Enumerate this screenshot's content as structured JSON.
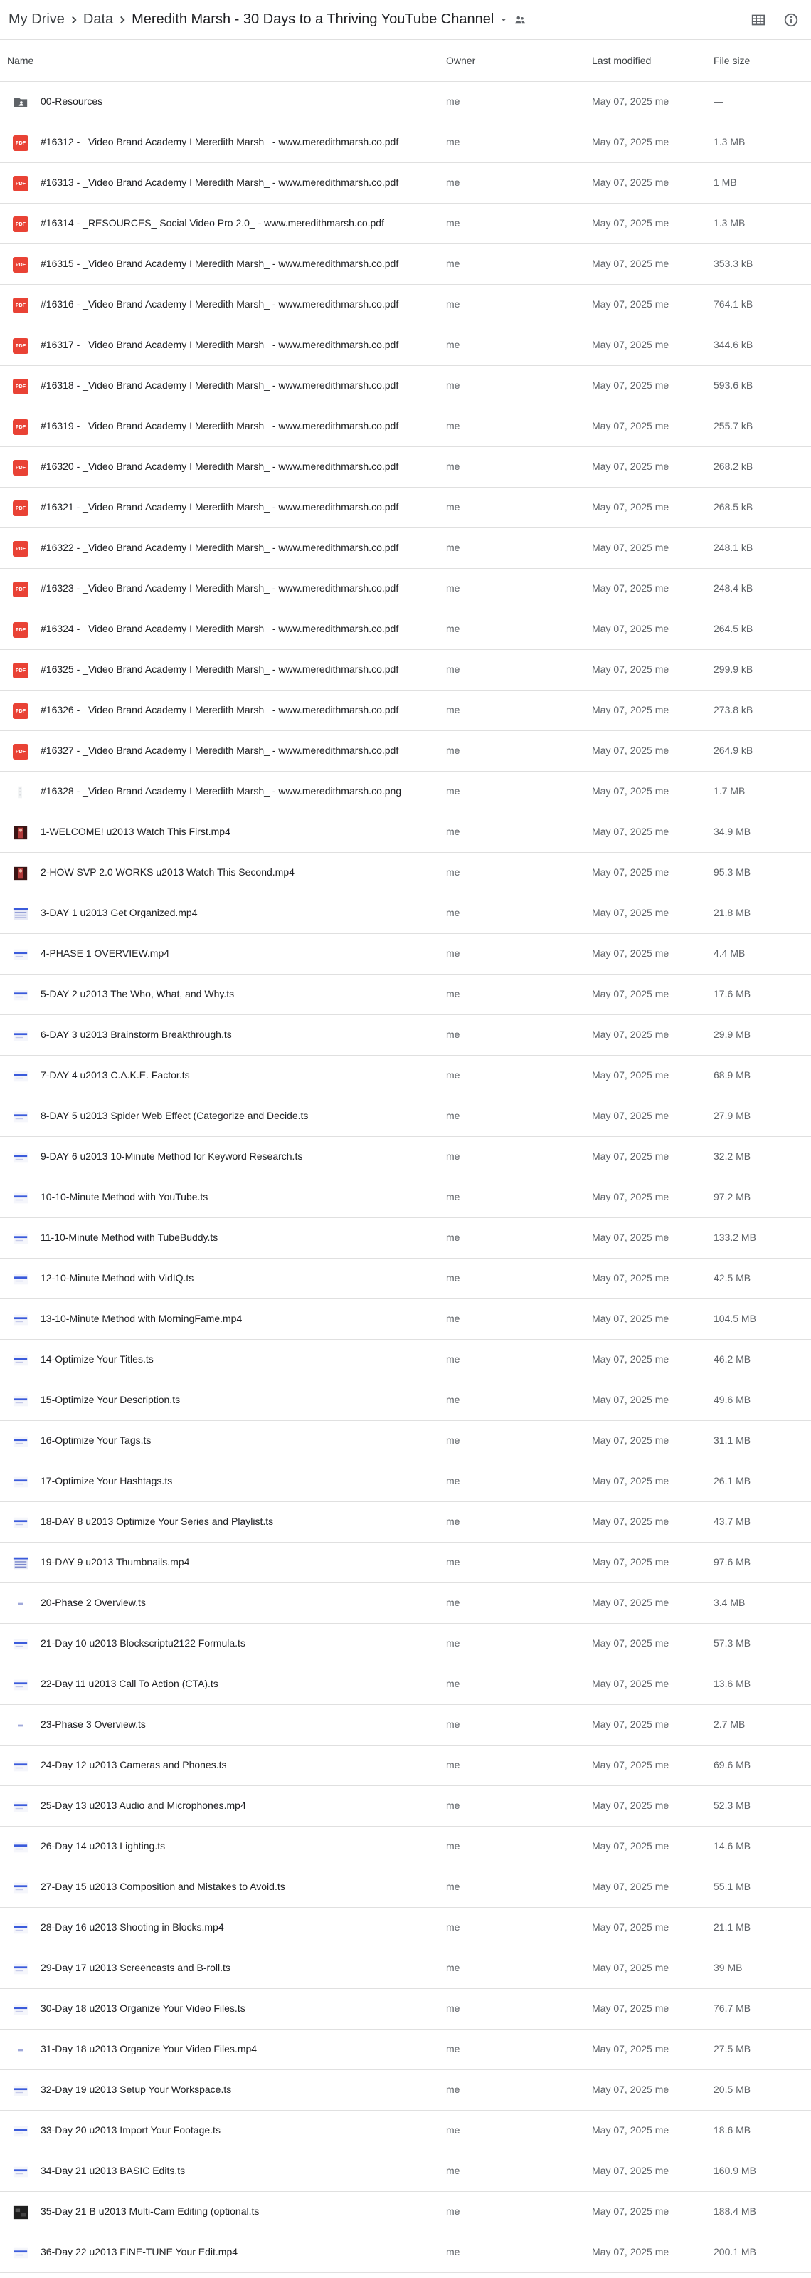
{
  "breadcrumb": {
    "items": [
      "My Drive",
      "Data",
      "Meredith Marsh - 30 Days to a Thriving YouTube Channel"
    ]
  },
  "columns": {
    "name": "Name",
    "owner": "Owner",
    "modified": "Last modified",
    "size": "File size"
  },
  "files": [
    {
      "type": "folder",
      "name": "00-Resources",
      "owner": "me",
      "modified": "May 07, 2025 me",
      "size": "—"
    },
    {
      "type": "pdf",
      "name": "#16312 - _Video Brand Academy I Meredith Marsh_ - www.meredithmarsh.co.pdf",
      "owner": "me",
      "modified": "May 07, 2025 me",
      "size": "1.3 MB"
    },
    {
      "type": "pdf",
      "name": "#16313 - _Video Brand Academy I Meredith Marsh_ - www.meredithmarsh.co.pdf",
      "owner": "me",
      "modified": "May 07, 2025 me",
      "size": "1 MB"
    },
    {
      "type": "pdf",
      "name": "#16314 - _RESOURCES_ Social Video Pro 2.0_ - www.meredithmarsh.co.pdf",
      "owner": "me",
      "modified": "May 07, 2025 me",
      "size": "1.3 MB"
    },
    {
      "type": "pdf",
      "name": "#16315 - _Video Brand Academy I Meredith Marsh_ - www.meredithmarsh.co.pdf",
      "owner": "me",
      "modified": "May 07, 2025 me",
      "size": "353.3 kB"
    },
    {
      "type": "pdf",
      "name": "#16316 - _Video Brand Academy I Meredith Marsh_ - www.meredithmarsh.co.pdf",
      "owner": "me",
      "modified": "May 07, 2025 me",
      "size": "764.1 kB"
    },
    {
      "type": "pdf",
      "name": "#16317 - _Video Brand Academy I Meredith Marsh_ - www.meredithmarsh.co.pdf",
      "owner": "me",
      "modified": "May 07, 2025 me",
      "size": "344.6 kB"
    },
    {
      "type": "pdf",
      "name": "#16318 - _Video Brand Academy I Meredith Marsh_ - www.meredithmarsh.co.pdf",
      "owner": "me",
      "modified": "May 07, 2025 me",
      "size": "593.6 kB"
    },
    {
      "type": "pdf",
      "name": "#16319 - _Video Brand Academy I Meredith Marsh_ - www.meredithmarsh.co.pdf",
      "owner": "me",
      "modified": "May 07, 2025 me",
      "size": "255.7 kB"
    },
    {
      "type": "pdf",
      "name": "#16320 - _Video Brand Academy I Meredith Marsh_ - www.meredithmarsh.co.pdf",
      "owner": "me",
      "modified": "May 07, 2025 me",
      "size": "268.2 kB"
    },
    {
      "type": "pdf",
      "name": "#16321 - _Video Brand Academy I Meredith Marsh_ - www.meredithmarsh.co.pdf",
      "owner": "me",
      "modified": "May 07, 2025 me",
      "size": "268.5 kB"
    },
    {
      "type": "pdf",
      "name": "#16322 - _Video Brand Academy I Meredith Marsh_ - www.meredithmarsh.co.pdf",
      "owner": "me",
      "modified": "May 07, 2025 me",
      "size": "248.1 kB"
    },
    {
      "type": "pdf",
      "name": "#16323 - _Video Brand Academy I Meredith Marsh_ - www.meredithmarsh.co.pdf",
      "owner": "me",
      "modified": "May 07, 2025 me",
      "size": "248.4 kB"
    },
    {
      "type": "pdf",
      "name": "#16324 - _Video Brand Academy I Meredith Marsh_ - www.meredithmarsh.co.pdf",
      "owner": "me",
      "modified": "May 07, 2025 me",
      "size": "264.5 kB"
    },
    {
      "type": "pdf",
      "name": "#16325 - _Video Brand Academy I Meredith Marsh_ - www.meredithmarsh.co.pdf",
      "owner": "me",
      "modified": "May 07, 2025 me",
      "size": "299.9 kB"
    },
    {
      "type": "pdf",
      "name": "#16326 - _Video Brand Academy I Meredith Marsh_ - www.meredithmarsh.co.pdf",
      "owner": "me",
      "modified": "May 07, 2025 me",
      "size": "273.8 kB"
    },
    {
      "type": "pdf",
      "name": "#16327 - _Video Brand Academy I Meredith Marsh_ - www.meredithmarsh.co.pdf",
      "owner": "me",
      "modified": "May 07, 2025 me",
      "size": "264.9 kB"
    },
    {
      "type": "png",
      "name": "#16328 - _Video Brand Academy I Meredith Marsh_ - www.meredithmarsh.co.png",
      "owner": "me",
      "modified": "May 07, 2025 me",
      "size": "1.7 MB"
    },
    {
      "type": "thumb-red",
      "name": "1-WELCOME! u2013 Watch This First.mp4",
      "owner": "me",
      "modified": "May 07, 2025 me",
      "size": "34.9 MB"
    },
    {
      "type": "thumb-red",
      "name": "2-HOW SVP 2.0 WORKS u2013 Watch This Second.mp4",
      "owner": "me",
      "modified": "May 07, 2025 me",
      "size": "95.3 MB"
    },
    {
      "type": "thumb-lines",
      "name": "3-DAY 1 u2013 Get Organized.mp4",
      "owner": "me",
      "modified": "May 07, 2025 me",
      "size": "21.8 MB"
    },
    {
      "type": "thumb-blue",
      "name": "4-PHASE 1 OVERVIEW.mp4",
      "owner": "me",
      "modified": "May 07, 2025 me",
      "size": "4.4 MB"
    },
    {
      "type": "thumb-blue",
      "name": "5-DAY 2 u2013 The Who, What, and Why.ts",
      "owner": "me",
      "modified": "May 07, 2025 me",
      "size": "17.6 MB"
    },
    {
      "type": "thumb-blue",
      "name": "6-DAY 3 u2013 Brainstorm Breakthrough.ts",
      "owner": "me",
      "modified": "May 07, 2025 me",
      "size": "29.9 MB"
    },
    {
      "type": "thumb-blue",
      "name": "7-DAY 4 u2013 C.A.K.E. Factor.ts",
      "owner": "me",
      "modified": "May 07, 2025 me",
      "size": "68.9 MB"
    },
    {
      "type": "thumb-blue",
      "name": "8-DAY 5 u2013 Spider Web Effect (Categorize and Decide.ts",
      "owner": "me",
      "modified": "May 07, 2025 me",
      "size": "27.9 MB"
    },
    {
      "type": "thumb-blue",
      "name": "9-DAY 6 u2013 10-Minute Method for Keyword Research.ts",
      "owner": "me",
      "modified": "May 07, 2025 me",
      "size": "32.2 MB"
    },
    {
      "type": "thumb-blue",
      "name": "10-10-Minute Method with YouTube.ts",
      "owner": "me",
      "modified": "May 07, 2025 me",
      "size": "97.2 MB"
    },
    {
      "type": "thumb-blue",
      "name": "11-10-Minute Method with TubeBuddy.ts",
      "owner": "me",
      "modified": "May 07, 2025 me",
      "size": "133.2 MB"
    },
    {
      "type": "thumb-blue",
      "name": "12-10-Minute Method with VidIQ.ts",
      "owner": "me",
      "modified": "May 07, 2025 me",
      "size": "42.5 MB"
    },
    {
      "type": "thumb-blue",
      "name": "13-10-Minute Method with MorningFame.mp4",
      "owner": "me",
      "modified": "May 07, 2025 me",
      "size": "104.5 MB"
    },
    {
      "type": "thumb-blue",
      "name": "14-Optimize Your Titles.ts",
      "owner": "me",
      "modified": "May 07, 2025 me",
      "size": "46.2 MB"
    },
    {
      "type": "thumb-blue",
      "name": "15-Optimize Your Description.ts",
      "owner": "me",
      "modified": "May 07, 2025 me",
      "size": "49.6 MB"
    },
    {
      "type": "thumb-blue",
      "name": "16-Optimize Your Tags.ts",
      "owner": "me",
      "modified": "May 07, 2025 me",
      "size": "31.1 MB"
    },
    {
      "type": "thumb-blue",
      "name": "17-Optimize Your Hashtags.ts",
      "owner": "me",
      "modified": "May 07, 2025 me",
      "size": "26.1 MB"
    },
    {
      "type": "thumb-blue",
      "name": "18-DAY 8 u2013 Optimize Your Series and Playlist.ts",
      "owner": "me",
      "modified": "May 07, 2025 me",
      "size": "43.7 MB"
    },
    {
      "type": "thumb-lines",
      "name": "19-DAY 9 u2013 Thumbnails.mp4",
      "owner": "me",
      "modified": "May 07, 2025 me",
      "size": "97.6 MB"
    },
    {
      "type": "thumb-dash",
      "name": "20-Phase 2 Overview.ts",
      "owner": "me",
      "modified": "May 07, 2025 me",
      "size": "3.4 MB"
    },
    {
      "type": "thumb-blue",
      "name": "21-Day 10 u2013 Blockscriptu2122 Formula.ts",
      "owner": "me",
      "modified": "May 07, 2025 me",
      "size": "57.3 MB"
    },
    {
      "type": "thumb-blue",
      "name": "22-Day 11 u2013 Call To Action (CTA).ts",
      "owner": "me",
      "modified": "May 07, 2025 me",
      "size": "13.6 MB"
    },
    {
      "type": "thumb-dash",
      "name": "23-Phase 3 Overview.ts",
      "owner": "me",
      "modified": "May 07, 2025 me",
      "size": "2.7 MB"
    },
    {
      "type": "thumb-blue",
      "name": "24-Day 12 u2013 Cameras and Phones.ts",
      "owner": "me",
      "modified": "May 07, 2025 me",
      "size": "69.6 MB"
    },
    {
      "type": "thumb-blue",
      "name": "25-Day 13 u2013 Audio and Microphones.mp4",
      "owner": "me",
      "modified": "May 07, 2025 me",
      "size": "52.3 MB"
    },
    {
      "type": "thumb-blue",
      "name": "26-Day 14 u2013 Lighting.ts",
      "owner": "me",
      "modified": "May 07, 2025 me",
      "size": "14.6 MB"
    },
    {
      "type": "thumb-blue",
      "name": "27-Day 15 u2013 Composition and Mistakes to Avoid.ts",
      "owner": "me",
      "modified": "May 07, 2025 me",
      "size": "55.1 MB"
    },
    {
      "type": "thumb-blue",
      "name": "28-Day 16 u2013 Shooting in Blocks.mp4",
      "owner": "me",
      "modified": "May 07, 2025 me",
      "size": "21.1 MB"
    },
    {
      "type": "thumb-blue",
      "name": "29-Day 17 u2013 Screencasts and B-roll.ts",
      "owner": "me",
      "modified": "May 07, 2025 me",
      "size": "39 MB"
    },
    {
      "type": "thumb-blue",
      "name": "30-Day 18 u2013 Organize Your Video Files.ts",
      "owner": "me",
      "modified": "May 07, 2025 me",
      "size": "76.7 MB"
    },
    {
      "type": "thumb-dash",
      "name": "31-Day 18 u2013 Organize Your Video Files.mp4",
      "owner": "me",
      "modified": "May 07, 2025 me",
      "size": "27.5 MB"
    },
    {
      "type": "thumb-blue",
      "name": "32-Day 19 u2013 Setup Your Workspace.ts",
      "owner": "me",
      "modified": "May 07, 2025 me",
      "size": "20.5 MB"
    },
    {
      "type": "thumb-blue",
      "name": "33-Day 20 u2013 Import Your Footage.ts",
      "owner": "me",
      "modified": "May 07, 2025 me",
      "size": "18.6 MB"
    },
    {
      "type": "thumb-blue",
      "name": "34-Day 21 u2013 BASIC Edits.ts",
      "owner": "me",
      "modified": "May 07, 2025 me",
      "size": "160.9 MB"
    },
    {
      "type": "thumb-dark",
      "name": "35-Day 21 B u2013 Multi-Cam Editing (optional.ts",
      "owner": "me",
      "modified": "May 07, 2025 me",
      "size": "188.4 MB"
    },
    {
      "type": "thumb-blue",
      "name": "36-Day 22 u2013 FINE-TUNE Your Edit.mp4",
      "owner": "me",
      "modified": "May 07, 2025 me",
      "size": "200.1 MB"
    }
  ],
  "icons": {
    "pdf_label": "PDF",
    "pdf_color": "#e94235",
    "folder_color": "#5f6368",
    "thumb_blue": "#3b5bdb"
  }
}
